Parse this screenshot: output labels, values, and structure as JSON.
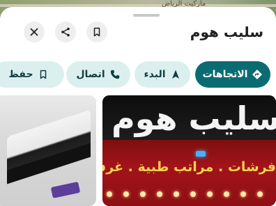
{
  "map": {
    "label": "ماركيت الرياض"
  },
  "place": {
    "title": "سليب هوم"
  },
  "top_buttons": {
    "close_icon": "close-icon",
    "share_icon": "share-icon",
    "save_icon": "bookmark-icon"
  },
  "actions": [
    {
      "label": "الاتجاهات",
      "icon": "directions-icon",
      "style": "primary"
    },
    {
      "label": "البدء",
      "icon": "navigation-icon",
      "style": "secondary"
    },
    {
      "label": "اتصال",
      "icon": "phone-icon",
      "style": "secondary"
    },
    {
      "label": "حفظ",
      "icon": "bookmark-icon",
      "style": "secondary"
    }
  ],
  "photos": {
    "storefront_sign_main": "سليب هوم",
    "storefront_sign_sub": "فرشات . مراتب طبية . غرف نوم . أثاث"
  },
  "colors": {
    "primary": "#0b6b73",
    "secondary_chip": "#dcefef",
    "sign_red": "#a3131a"
  }
}
